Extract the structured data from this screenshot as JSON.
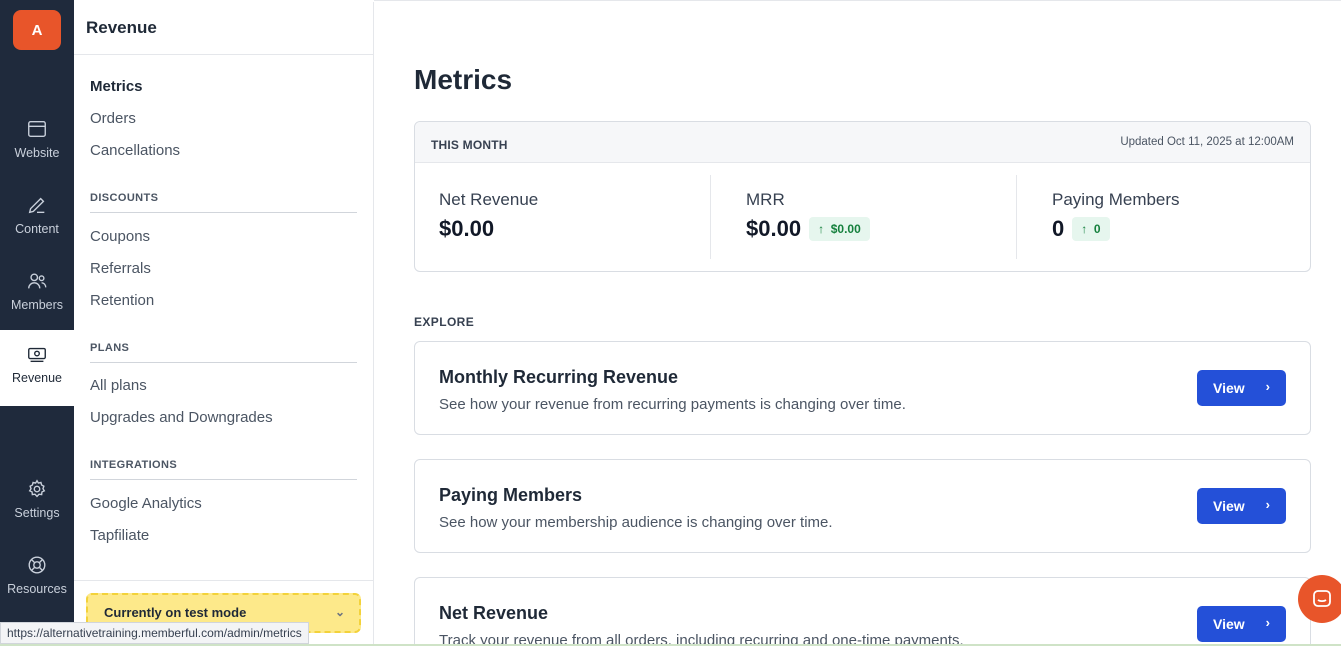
{
  "rail": {
    "avatar_letter": "A",
    "items": [
      {
        "label": "Website",
        "icon": "browser-icon"
      },
      {
        "label": "Content",
        "icon": "pencil-icon"
      },
      {
        "label": "Members",
        "icon": "users-icon"
      },
      {
        "label": "Revenue",
        "icon": "money-icon"
      },
      {
        "label": "Settings",
        "icon": "gear-icon"
      },
      {
        "label": "Resources",
        "icon": "lifebuoy-icon"
      }
    ]
  },
  "sidebar": {
    "title": "Revenue",
    "top_links": [
      "Metrics",
      "Orders",
      "Cancellations"
    ],
    "sections": [
      {
        "title": "DISCOUNTS",
        "links": [
          "Coupons",
          "Referrals",
          "Retention"
        ]
      },
      {
        "title": "PLANS",
        "links": [
          "All plans",
          "Upgrades and Downgrades"
        ]
      },
      {
        "title": "INTEGRATIONS",
        "links": [
          "Google Analytics",
          "Tapfiliate"
        ]
      }
    ],
    "test_mode": "Currently on test mode"
  },
  "main": {
    "title": "Metrics",
    "this_month": {
      "label": "THIS MONTH",
      "updated": "Updated Oct 11, 2025 at 12:00AM",
      "stats": [
        {
          "name": "Net Revenue",
          "value": "$0.00",
          "delta": ""
        },
        {
          "name": "MRR",
          "value": "$0.00",
          "delta": "$0.00"
        },
        {
          "name": "Paying Members",
          "value": "0",
          "delta": "0"
        }
      ]
    },
    "explore_label": "EXPLORE",
    "explore": [
      {
        "title": "Monthly Recurring Revenue",
        "desc": "See how your revenue from recurring payments is changing over time.",
        "button": "View"
      },
      {
        "title": "Paying Members",
        "desc": "See how your membership audience is changing over time.",
        "button": "View"
      },
      {
        "title": "Net Revenue",
        "desc": "Track your revenue from all orders, including recurring and one-time payments.",
        "button": "View"
      }
    ]
  },
  "status_url": "https://alternativetraining.memberful.com/admin/metrics",
  "colors": {
    "accent": "#2450d8",
    "brand": "#e8552a",
    "rail": "#1f2a3c",
    "positive": "#15803d"
  }
}
